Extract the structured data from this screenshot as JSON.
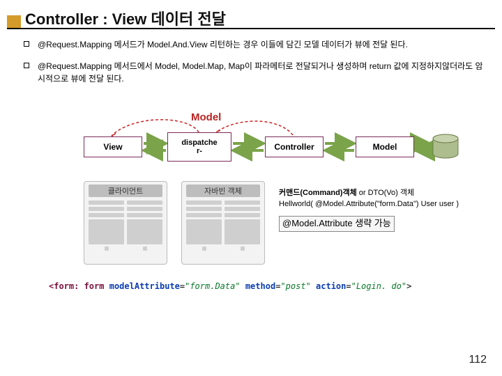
{
  "title": "Controller : View 데이터 전달",
  "bullets": [
    "@Request.Mapping 메서드가 Model.And.View 리턴하는 경우 이들에 담긴 모델 데이터가 뷰에 전달 된다.",
    "@Request.Mapping 메서드에서 Model, Model.Map, Map이 파라메터로 전달되거나 생성하며 return 값에 지정하지않더라도 암시적으로 뷰에 전달 된다."
  ],
  "diagram": {
    "topLabel": "Model",
    "view": "View",
    "dispatcher": "dispatche\nr-",
    "controller": "Controller",
    "model": "Model",
    "clientCard": "클라이언트",
    "beanCard": "자바빈 객체"
  },
  "annot": {
    "line1a": "커맨드(Command)객체",
    "line1b": " or DTO(Vo) 객체",
    "line2": "Hellworld( @Model.Attribute(\"form.Data\") User user )",
    "boxed": "@Model.Attribute 생략 가능"
  },
  "code": {
    "tag": "<form: form",
    "a1": "modelAttribute",
    "v1": "\"form.Data\"",
    "a2": "method",
    "v2": "\"post\"",
    "a3": "action",
    "v3": "\"Login. do\"",
    "end": ">"
  },
  "pageNumber": "112"
}
